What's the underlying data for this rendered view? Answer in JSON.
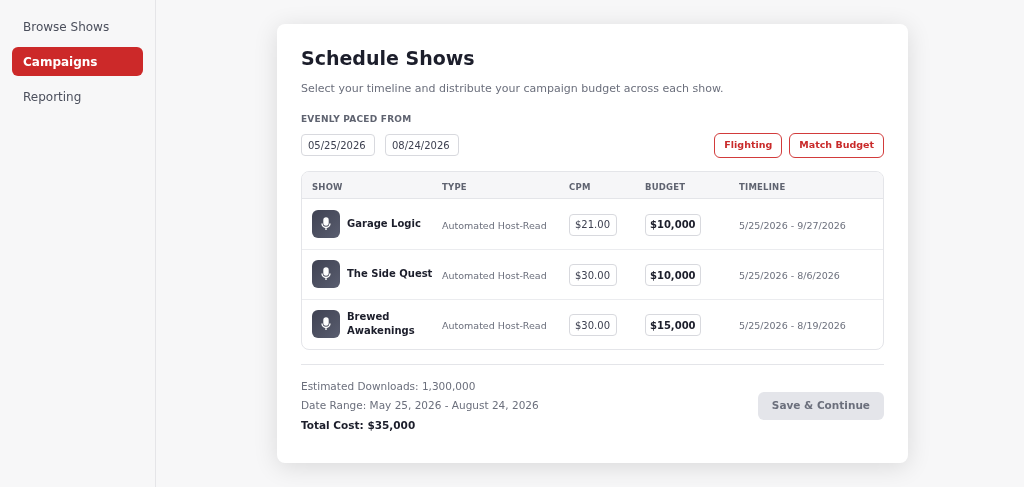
{
  "sidebar": {
    "items": [
      {
        "label": "Browse Shows",
        "selected": false
      },
      {
        "label": "Campaigns",
        "selected": true
      },
      {
        "label": "Reporting",
        "selected": false
      }
    ]
  },
  "card": {
    "title": "Schedule Shows",
    "subtitle": "Select your timeline and distribute your campaign budget across each show.",
    "pacing_label": "EVENLY PACED FROM",
    "start_date": "05/25/2026",
    "end_date": "08/24/2026",
    "actions": [
      "Flighting",
      "Match Budget"
    ],
    "table": {
      "columns": [
        "SHOW",
        "TYPE",
        "CPM",
        "BUDGET",
        "TIMELINE"
      ],
      "rows": [
        {
          "show": "Garage Logic",
          "type": "Automated Host-Read",
          "cpm": "$21.00",
          "budget": "$10,000",
          "timeline": "5/25/2026 - 9/27/2026"
        },
        {
          "show": "The Side Quest",
          "type": "Automated Host-Read",
          "cpm": "$30.00",
          "budget": "$10,000",
          "timeline": "5/25/2026 - 8/6/2026"
        },
        {
          "show": "Brewed Awakenings",
          "type": "Automated Host-Read",
          "cpm": "$30.00",
          "budget": "$15,000",
          "timeline": "5/25/2026 - 8/19/2026"
        }
      ]
    },
    "summary": [
      "Estimated Downloads: 1,300,000",
      "Date Range: May 25, 2026 - August 24, 2026"
    ],
    "total": "Total Cost: $35,000",
    "save_button": {
      "label": "Save & Continue",
      "disabled": true
    }
  }
}
